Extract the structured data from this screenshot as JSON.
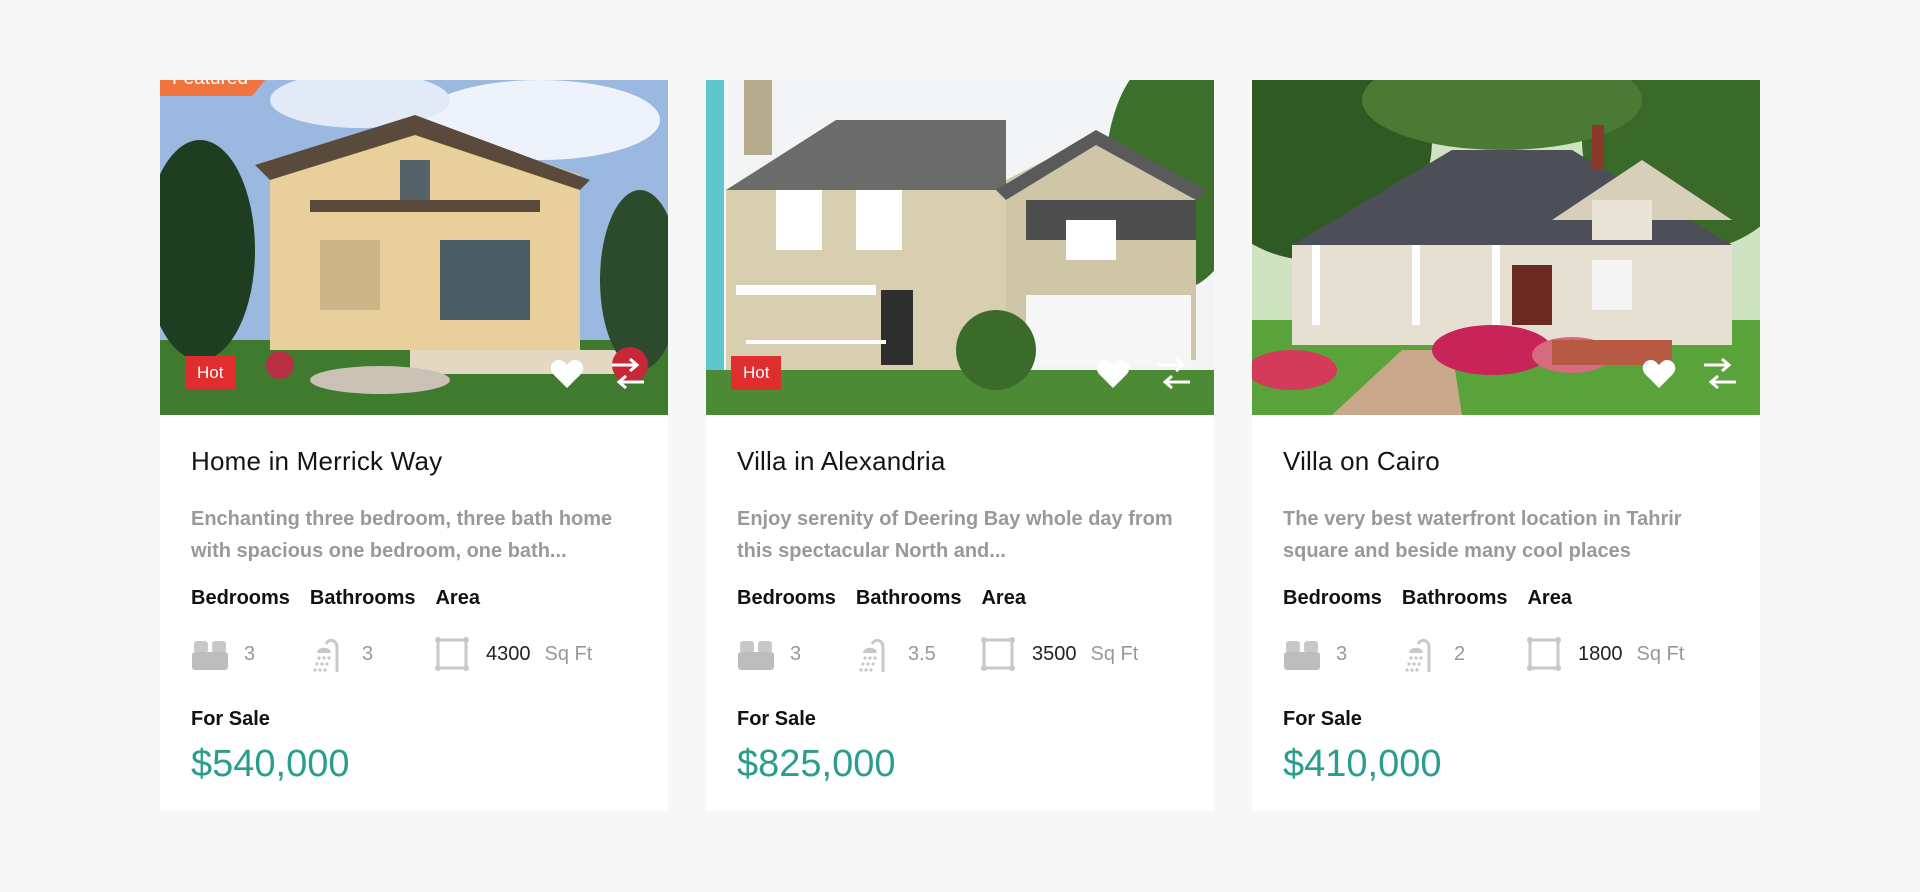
{
  "colors": {
    "page_bg": "#f7f7f7",
    "card_bg": "#ffffff",
    "featured_badge": "#f0743e",
    "hot_badge": "#e02d2d",
    "price": "#2a9d8f",
    "muted_text": "#999999"
  },
  "listings": [
    {
      "featured_label": "Featured",
      "badge": "Hot",
      "title": "Home in Merrick Way",
      "description": "Enchanting three bedroom, three bath home with spacious one bedroom, one bath...",
      "bedrooms_label": "Bedrooms",
      "bathrooms_label": "Bathrooms",
      "area_label": "Area",
      "bedrooms": "3",
      "bathrooms": "3",
      "area": "4300",
      "area_unit": "Sq Ft",
      "status": "For Sale",
      "price": "$540,000"
    },
    {
      "badge": "Hot",
      "title": "Villa in Alexandria",
      "description": "Enjoy serenity of Deering Bay whole day from this spectacular North and...",
      "bedrooms_label": "Bedrooms",
      "bathrooms_label": "Bathrooms",
      "area_label": "Area",
      "bedrooms": "3",
      "bathrooms": "3.5",
      "area": "3500",
      "area_unit": "Sq Ft",
      "status": "For Sale",
      "price": "$825,000"
    },
    {
      "title": "Villa on Cairo",
      "description": "The very best waterfront location in Tahrir square and beside many cool places",
      "bedrooms_label": "Bedrooms",
      "bathrooms_label": "Bathrooms",
      "area_label": "Area",
      "bedrooms": "3",
      "bathrooms": "2",
      "area": "1800",
      "area_unit": "Sq Ft",
      "status": "For Sale",
      "price": "$410,000"
    }
  ],
  "icons": [
    "heart-icon",
    "compare-arrows-icon",
    "bed-icon",
    "shower-icon",
    "area-icon"
  ]
}
